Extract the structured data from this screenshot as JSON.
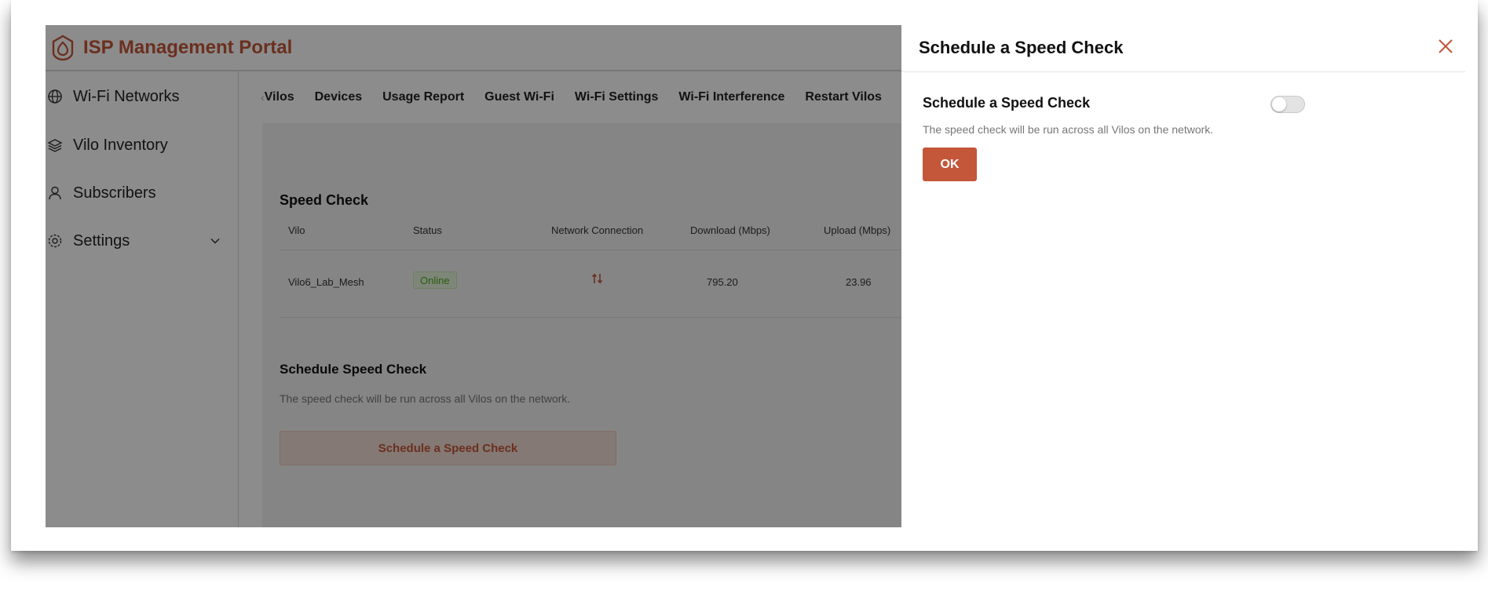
{
  "header": {
    "title": "ISP Management Portal"
  },
  "sidebar": {
    "items": [
      {
        "label": "Wi-Fi Networks"
      },
      {
        "label": "Vilo Inventory"
      },
      {
        "label": "Subscribers"
      },
      {
        "label": "Settings"
      }
    ]
  },
  "tabs": [
    "Vilos",
    "Devices",
    "Usage Report",
    "Guest Wi-Fi",
    "Wi-Fi Settings",
    "Wi-Fi Interference",
    "Restart Vilos"
  ],
  "speed_check": {
    "title": "Speed Check",
    "columns": [
      "Vilo",
      "Status",
      "Network Connection",
      "Download (Mbps)",
      "Upload (Mbps)"
    ],
    "rows": [
      {
        "vilo": "Vilo6_Lab_Mesh",
        "status": "Online",
        "download": "795.20",
        "upload": "23.96"
      }
    ]
  },
  "schedule": {
    "title": "Schedule Speed Check",
    "description": "The speed check will be run across all Vilos on the network.",
    "button": "Schedule a Speed Check"
  },
  "drawer": {
    "title": "Schedule a Speed Check",
    "toggle_label": "Schedule a Speed Check",
    "description": "The speed check will be run across all Vilos on the network.",
    "ok": "OK"
  },
  "colors": {
    "brand": "#c4573a",
    "online": "#4caa1a"
  }
}
